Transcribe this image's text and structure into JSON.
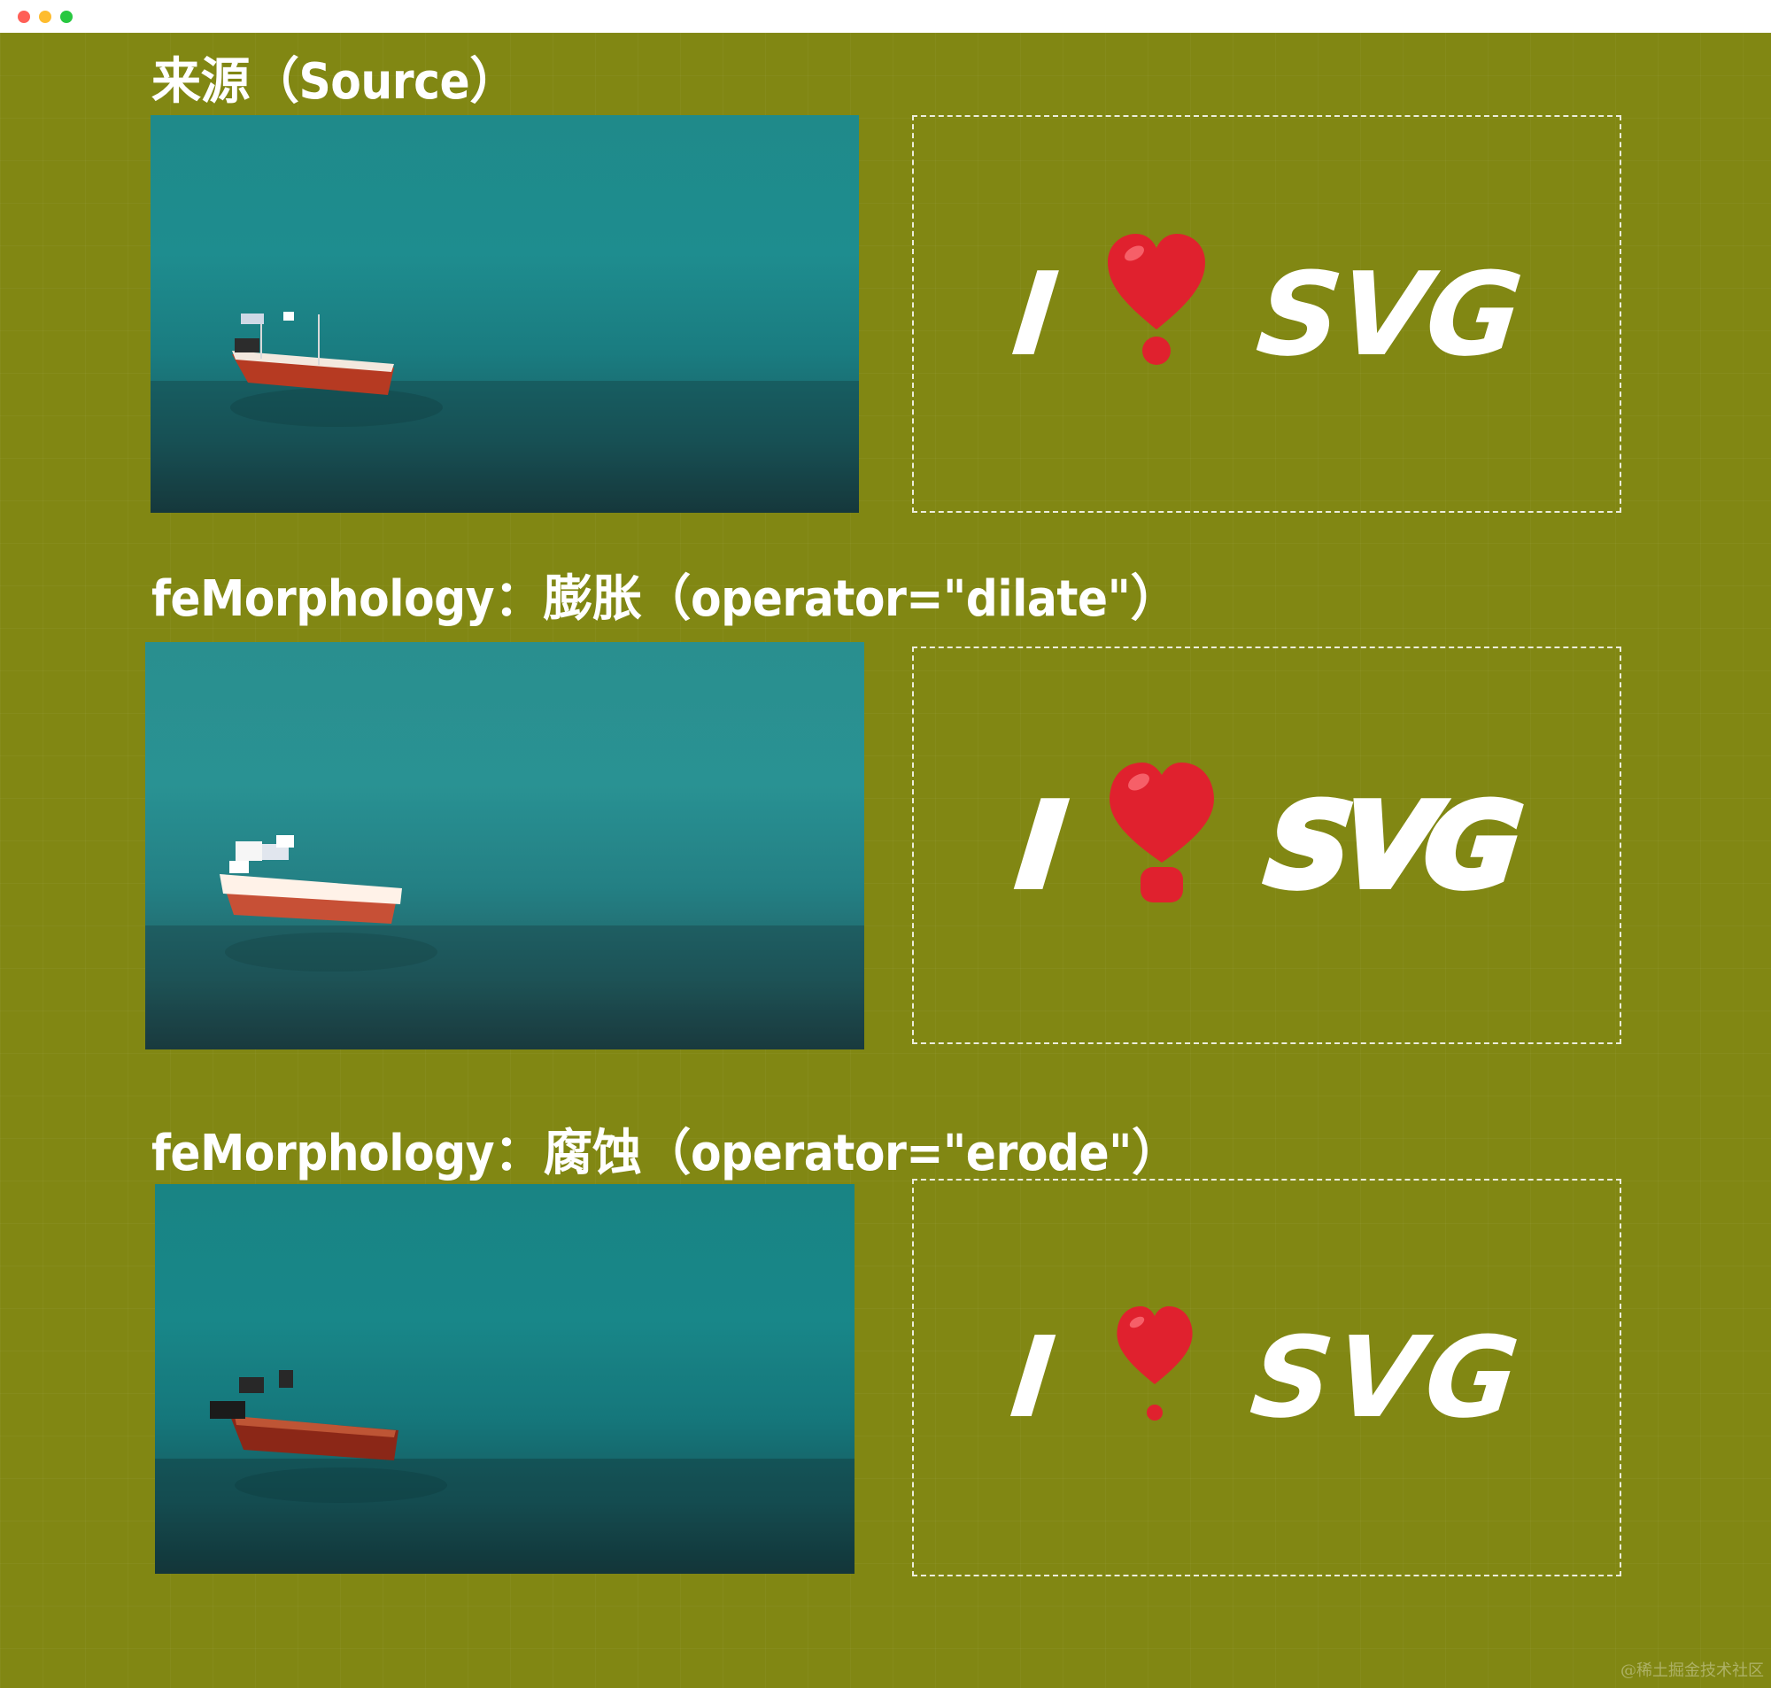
{
  "window": {
    "traffic_lights": [
      {
        "name": "close",
        "color": "#ff5f57"
      },
      {
        "name": "minimize",
        "color": "#febc2e"
      },
      {
        "name": "zoom",
        "color": "#28c840"
      }
    ]
  },
  "background_color": "#818713",
  "sections": [
    {
      "title": "来源（Source）",
      "banner": {
        "i_text": "I",
        "svg_text": "SVG",
        "heart_icon": "red-heart-exclamation-icon"
      }
    },
    {
      "title": "feMorphology：膨胀（operator=\"dilate\"）",
      "banner": {
        "i_text": "I",
        "svg_text": "SVG",
        "heart_icon": "red-heart-exclamation-icon"
      }
    },
    {
      "title": "feMorphology：腐蚀（operator=\"erode\"）",
      "banner": {
        "i_text": "I",
        "svg_text": "SVG",
        "heart_icon": "red-heart-exclamation-icon"
      }
    }
  ],
  "watermark": "@稀土掘金技术社区"
}
